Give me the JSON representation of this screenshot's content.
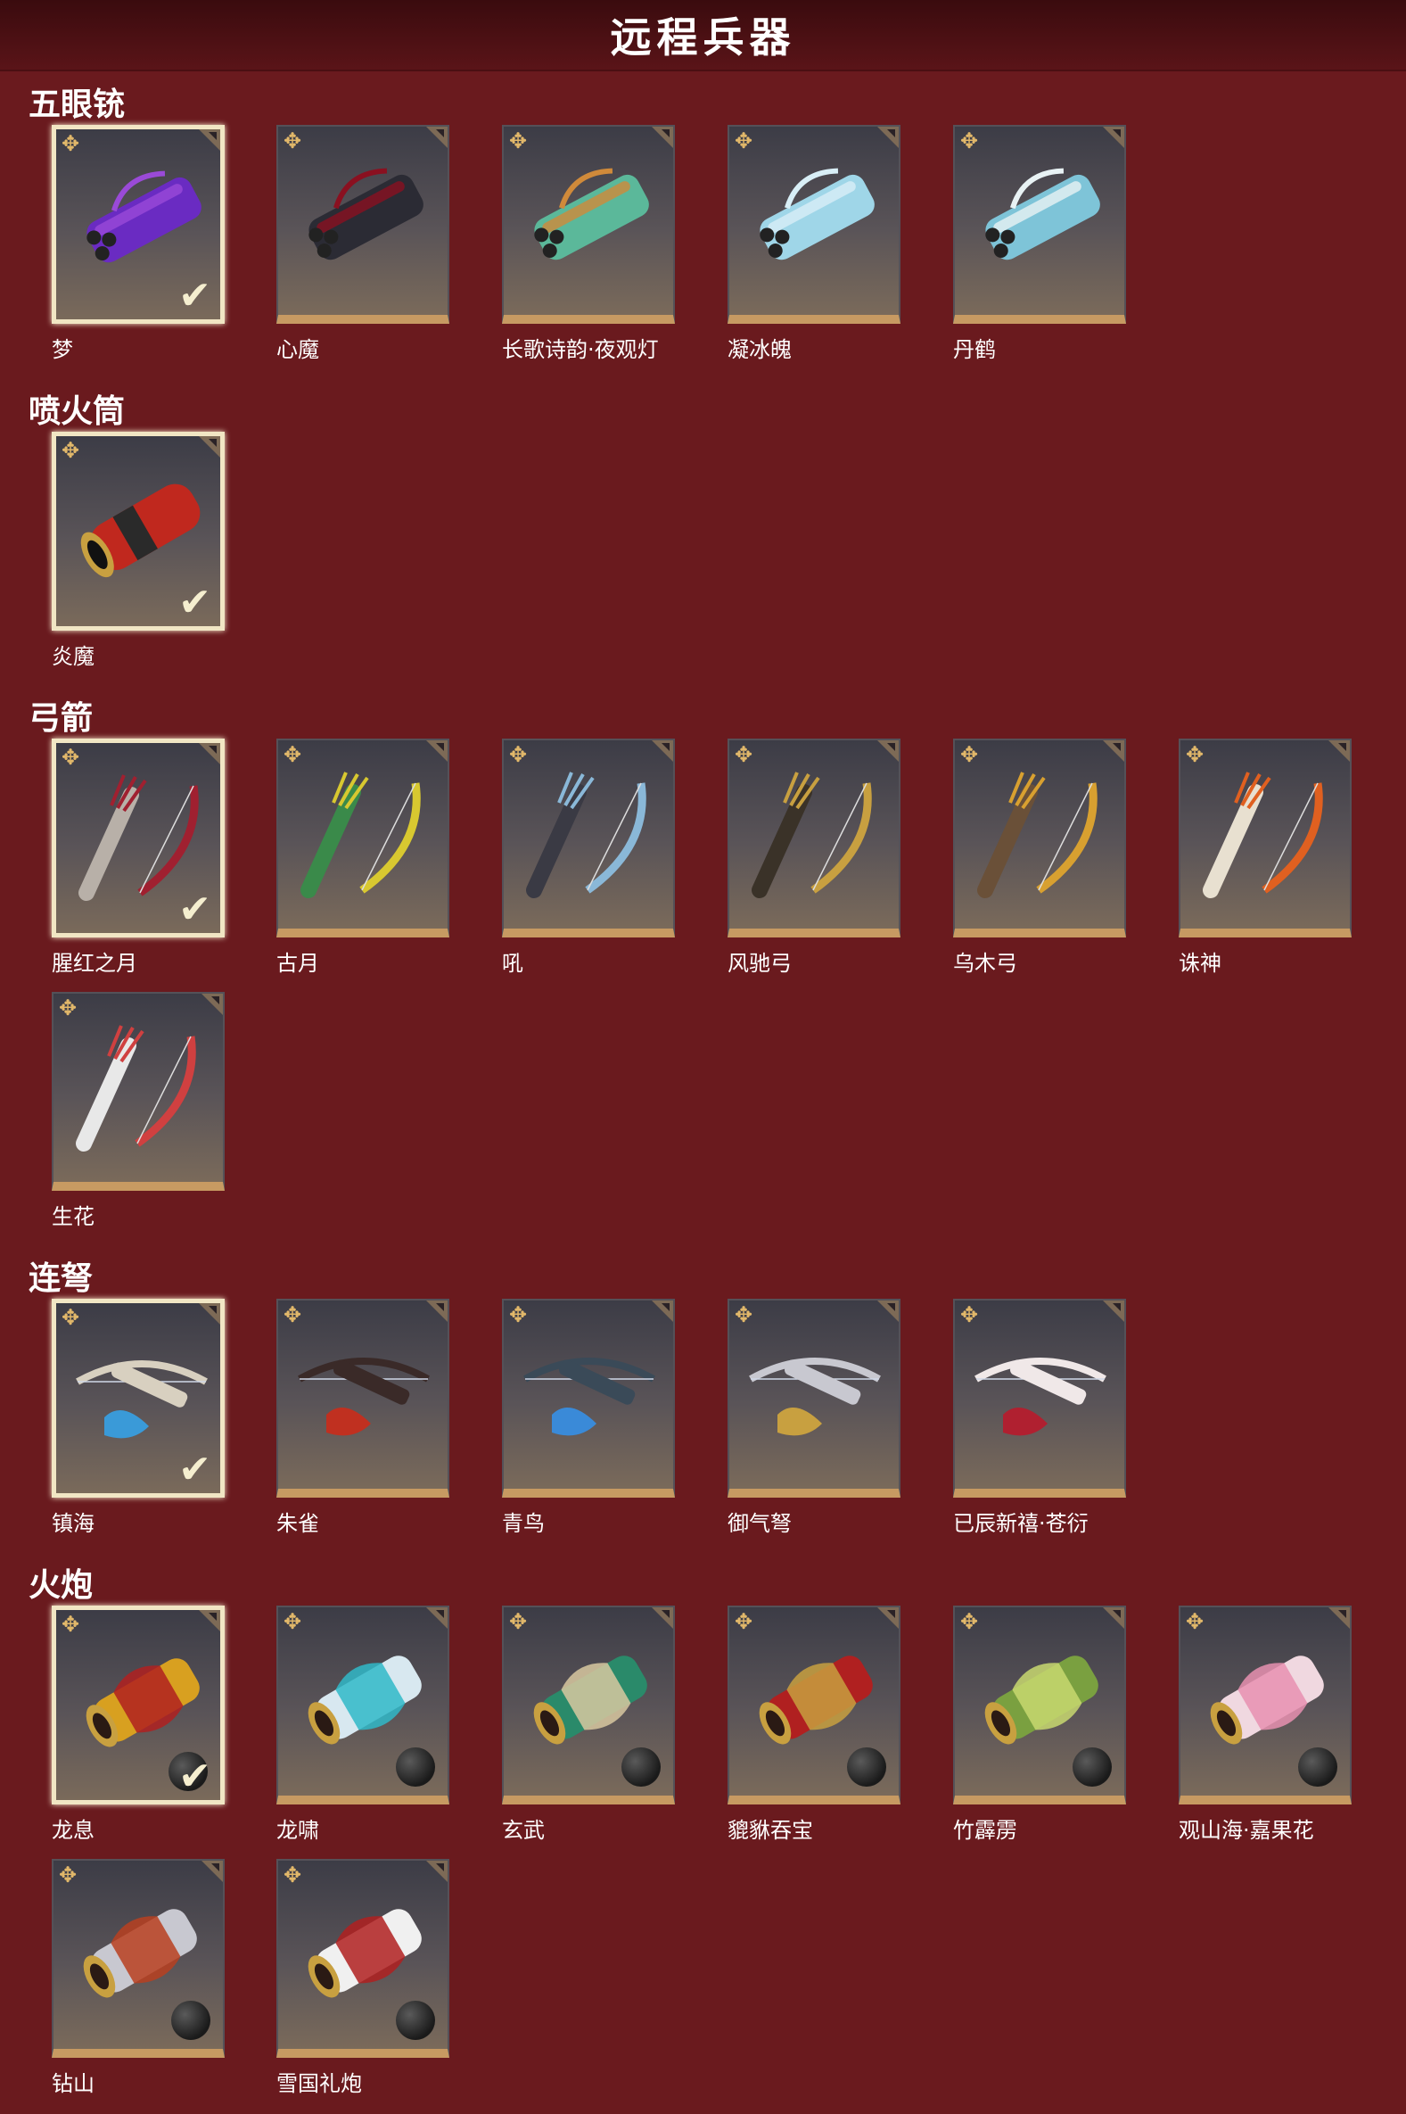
{
  "header": {
    "title": "远程兵器"
  },
  "categories": [
    {
      "title": "五眼铳",
      "items": [
        {
          "name": "梦",
          "selected": true,
          "colors": [
            "#6a2bc2",
            "#9a4ad8"
          ],
          "art": "gun"
        },
        {
          "name": "心魔",
          "selected": false,
          "colors": [
            "#2b2b34",
            "#8a1020"
          ],
          "art": "gun"
        },
        {
          "name": "长歌诗韵·夜观灯",
          "selected": false,
          "colors": [
            "#5bb89a",
            "#d08a3a"
          ],
          "art": "gun"
        },
        {
          "name": "凝冰魄",
          "selected": false,
          "colors": [
            "#9fd6e8",
            "#d8eef6"
          ],
          "art": "gun"
        },
        {
          "name": "丹鹤",
          "selected": false,
          "colors": [
            "#7ec4d8",
            "#e8f2f4"
          ],
          "art": "gun"
        }
      ]
    },
    {
      "title": "喷火筒",
      "items": [
        {
          "name": "炎魔",
          "selected": true,
          "colors": [
            "#c0281e",
            "#2a2a2a"
          ],
          "art": "tube"
        }
      ]
    },
    {
      "title": "弓箭",
      "items": [
        {
          "name": "腥红之月",
          "selected": true,
          "colors": [
            "#b8b0a8",
            "#a02030"
          ],
          "art": "bow"
        },
        {
          "name": "古月",
          "selected": false,
          "colors": [
            "#3a8a4a",
            "#d8c830"
          ],
          "art": "bow"
        },
        {
          "name": "吼",
          "selected": false,
          "colors": [
            "#3a3a44",
            "#8ab8d8"
          ],
          "art": "bow"
        },
        {
          "name": "风驰弓",
          "selected": false,
          "colors": [
            "#3a3228",
            "#c8a040"
          ],
          "art": "bow"
        },
        {
          "name": "乌木弓",
          "selected": false,
          "colors": [
            "#6a5038",
            "#d8a030"
          ],
          "art": "bow"
        },
        {
          "name": "诛神",
          "selected": false,
          "colors": [
            "#e8e0d0",
            "#e06020"
          ],
          "art": "bow"
        },
        {
          "name": "生花",
          "selected": false,
          "colors": [
            "#e8e8e8",
            "#d04040"
          ],
          "art": "bow"
        }
      ]
    },
    {
      "title": "连弩",
      "items": [
        {
          "name": "镇海",
          "selected": true,
          "colors": [
            "#d8d0c0",
            "#3a9ad8"
          ],
          "art": "crossbow"
        },
        {
          "name": "朱雀",
          "selected": false,
          "colors": [
            "#3a2a28",
            "#c03020"
          ],
          "art": "crossbow"
        },
        {
          "name": "青鸟",
          "selected": false,
          "colors": [
            "#3a4a58",
            "#3a8ad8"
          ],
          "art": "crossbow"
        },
        {
          "name": "御气弩",
          "selected": false,
          "colors": [
            "#c8c8d0",
            "#c8a040"
          ],
          "art": "crossbow"
        },
        {
          "name": "已辰新禧·苍衍",
          "selected": false,
          "colors": [
            "#f0e8e8",
            "#b02030"
          ],
          "art": "crossbow"
        }
      ]
    },
    {
      "title": "火炮",
      "items": [
        {
          "name": "龙息",
          "selected": true,
          "colors": [
            "#d8a020",
            "#b02020"
          ],
          "art": "cannon"
        },
        {
          "name": "龙啸",
          "selected": false,
          "colors": [
            "#d8e8f0",
            "#30b8c8"
          ],
          "art": "cannon"
        },
        {
          "name": "玄武",
          "selected": false,
          "colors": [
            "#2a8a6a",
            "#d8c8a0"
          ],
          "art": "cannon"
        },
        {
          "name": "貔貅吞宝",
          "selected": false,
          "colors": [
            "#b02020",
            "#c8a040"
          ],
          "art": "cannon"
        },
        {
          "name": "竹霹雳",
          "selected": false,
          "colors": [
            "#7aa040",
            "#c8d870"
          ],
          "art": "cannon"
        },
        {
          "name": "观山海·嘉果花",
          "selected": false,
          "colors": [
            "#f0d8e0",
            "#e890b0"
          ],
          "art": "cannon"
        },
        {
          "name": "钻山",
          "selected": false,
          "colors": [
            "#c8c8d0",
            "#b84020"
          ],
          "art": "cannon"
        },
        {
          "name": "雪国礼炮",
          "selected": false,
          "colors": [
            "#f0f0f0",
            "#b02020"
          ],
          "art": "cannon"
        }
      ]
    }
  ],
  "icons": {
    "corner_star": "shuriken-icon",
    "selected_mark": "checkmark-icon",
    "cannonball": "cannonball-icon"
  }
}
